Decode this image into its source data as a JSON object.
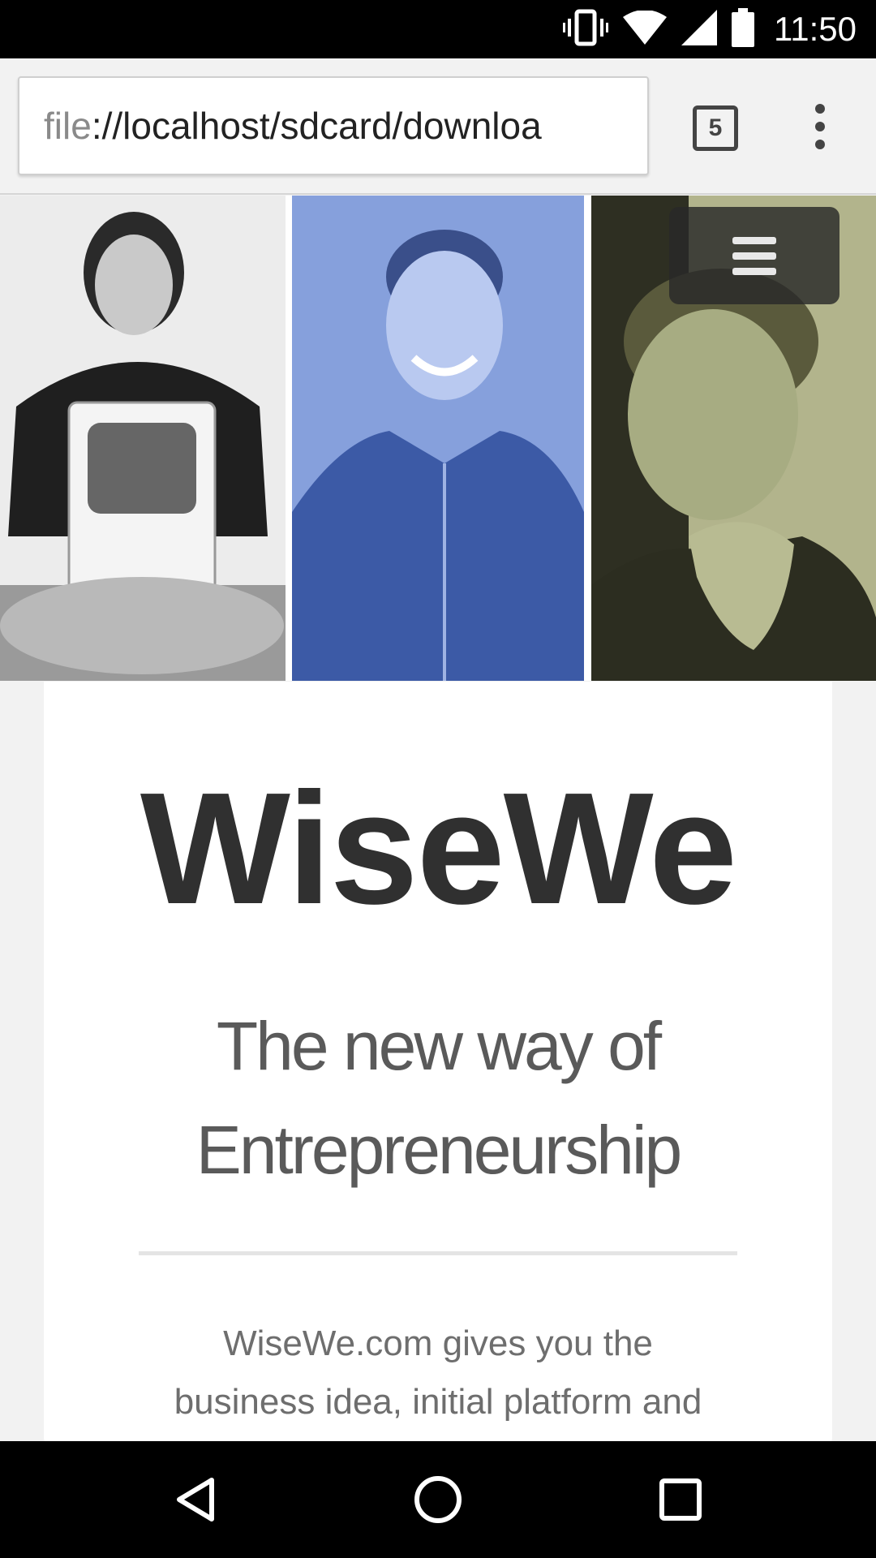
{
  "status_bar": {
    "time": "11:50",
    "icons": [
      "vibrate-icon",
      "wifi-icon",
      "signal-icon",
      "battery-icon"
    ]
  },
  "browser": {
    "url_scheme": "file",
    "url_rest": "://localhost/sdcard/downloa",
    "tab_count": "5",
    "icons": [
      "tabs-icon",
      "more-vert-icon"
    ]
  },
  "hero": {
    "images": [
      "portrait-1",
      "portrait-2",
      "portrait-3"
    ],
    "menu_icon": "hamburger-icon",
    "tints": {
      "portrait_1": "#e0e0e0",
      "portrait_2": "#7f99d8",
      "portrait_3": "#9aa27a"
    }
  },
  "card": {
    "brand": "WiseWe",
    "tagline_line1": "The new way of",
    "tagline_line2": "Entrepreneurship",
    "description_line1": "WiseWe.com gives you the",
    "description_line2": "business idea, initial platform and"
  },
  "nav_bar": {
    "icons": [
      "back-icon",
      "home-icon",
      "recents-icon"
    ]
  }
}
